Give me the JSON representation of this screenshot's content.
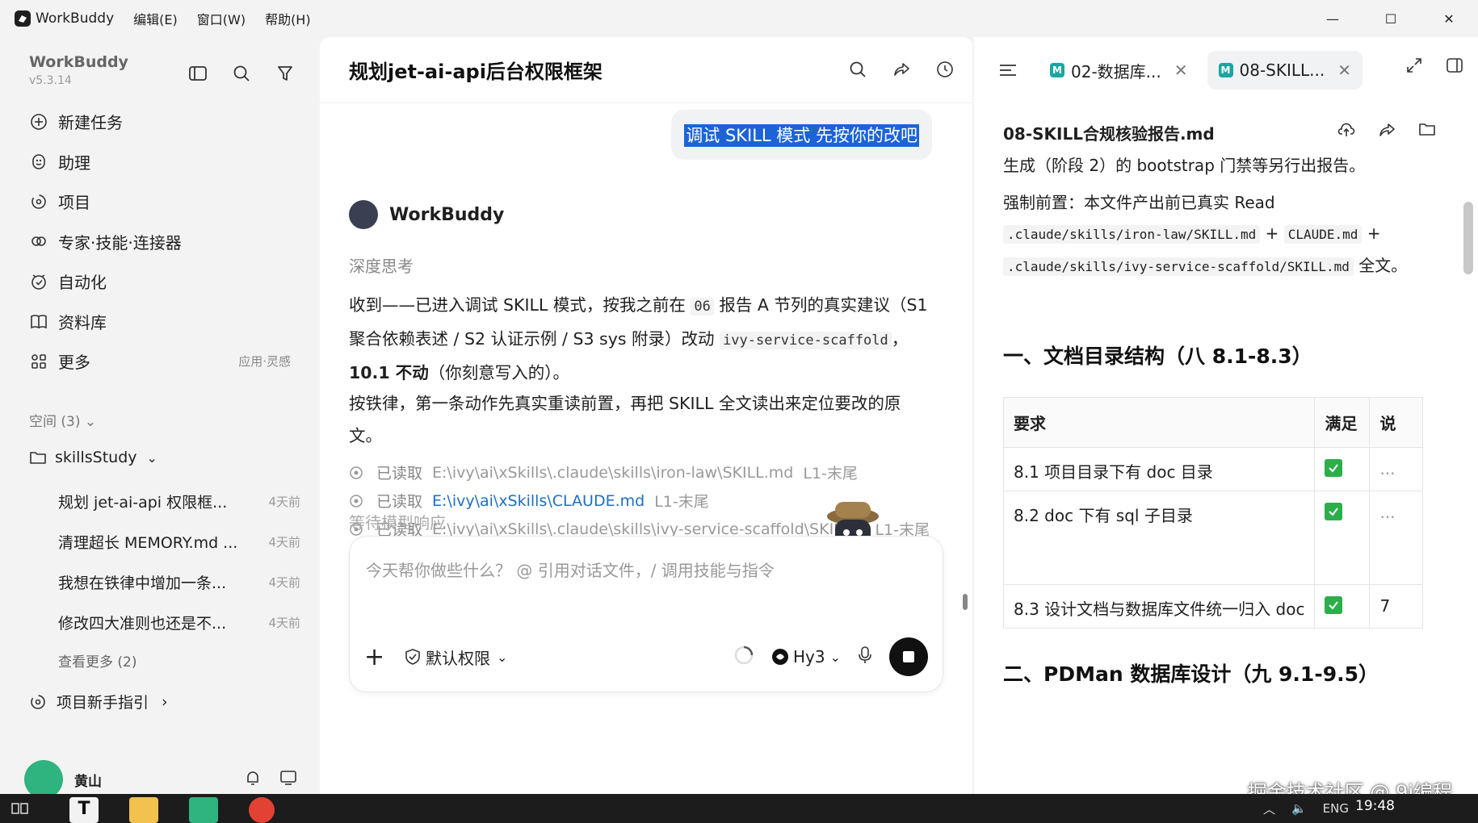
{
  "titlebar": {
    "app_name": "WorkBuddy",
    "menus": [
      "编辑(E)",
      "窗口(W)",
      "帮助(H)"
    ],
    "minimize": "—",
    "maximize": "☐",
    "close": "✕"
  },
  "sidebar": {
    "brand": "WorkBuddy",
    "version": "v5.3.14",
    "nav": [
      {
        "label": "新建任务",
        "icon": "plus-circle-icon"
      },
      {
        "label": "助理",
        "icon": "assistant-icon"
      },
      {
        "label": "项目",
        "icon": "project-icon"
      },
      {
        "label": "专家·技能·连接器",
        "icon": "expert-icon"
      },
      {
        "label": "自动化",
        "icon": "automation-icon"
      },
      {
        "label": "资料库",
        "icon": "library-icon"
      },
      {
        "label": "更多",
        "icon": "more-icon",
        "hint": "应用·灵感"
      }
    ],
    "space_header": "空间 (3)",
    "folder": "skillsStudy",
    "recent": [
      {
        "title": "规划 jet-ai-api 权限框...",
        "date": "4天前"
      },
      {
        "title": "清理超长 MEMORY.md ...",
        "date": "4天前"
      },
      {
        "title": "我想在铁律中增加一条...",
        "date": "4天前"
      },
      {
        "title": "修改四大准则也还是不...",
        "date": "4天前"
      }
    ],
    "see_more": "查看更多 (2)",
    "guide": "项目新手指引",
    "user_name": "黄山"
  },
  "chat": {
    "title": "规划jet-ai-api后台权限框架",
    "user_message": "调试 SKILL 模式 先按你的改吧",
    "bot_name": "WorkBuddy",
    "thinking": "深度思考",
    "p1_a": "收到——已进入调试 SKILL 模式，按我之前在 ",
    "p1_code1": "06",
    "p1_b": " 报告 A 节列的真实建议（S1 聚合依赖表述 / S2 认证示例 / S3 sys 附录）改动 ",
    "p1_code2": "ivy-service-scaffold",
    "p1_c": "，",
    "p1_bold": "10.1 不动",
    "p1_d": "（你刻意写入的）。",
    "p2": "按铁律，第一条动作先真实重读前置，再把 SKILL 全文读出来定位要改的原文。",
    "reads": [
      {
        "label": "已读取",
        "path": "E:\\ivy\\ai\\xSkills\\.claude\\skills\\iron-law\\SKILL.md",
        "range": "L1-末尾",
        "link": false
      },
      {
        "label": "已读取",
        "path": "E:\\ivy\\ai\\xSkills\\CLAUDE.md",
        "range": "L1-末尾",
        "link": true
      },
      {
        "label": "已读取",
        "path": "E:\\ivy\\ai\\xSkills\\.claude\\skills\\ivy-service-scaffold\\SKILL...",
        "range": "L1-末尾",
        "link": false
      }
    ],
    "waiting": "等待模型响应",
    "composer_placeholder": "今天帮你做些什么？  @ 引用对话文件，/ 调用技能与指令",
    "permission": "默认权限",
    "model": "Hy3"
  },
  "doc": {
    "tabs": [
      {
        "label": "02-数据库...",
        "active": false
      },
      {
        "label": "08-SKILL...",
        "active": true
      }
    ],
    "filename": "08-SKILL合规核验报告.md",
    "p_top": "生成（阶段 2）的 bootstrap 门禁等另行出报告。",
    "p_pre_a": "强制前置：本文件产出前已真实 Read",
    "p_pre_code1": ".claude/skills/iron-law/SKILL.md",
    "p_pre_plus1": "+",
    "p_pre_code2": "CLAUDE.md",
    "p_pre_plus2": "+",
    "p_pre_code3": ".claude/skills/ivy-service-scaffold/SKILL.md",
    "p_pre_b": "全文。",
    "h2_1": "一、文档目录结构（八 8.1-8.3）",
    "table_headers": [
      "要求",
      "满足",
      "说"
    ],
    "table_rows": [
      {
        "req": "8.1 项目目录下有 doc 目录",
        "ok": true,
        "note": "..."
      },
      {
        "req": "8.2 doc 下有 sql 子目录",
        "ok": true,
        "note": "..."
      },
      {
        "req": "8.3 设计文档与数据库文件统一归入 doc",
        "ok": true,
        "note": "7"
      }
    ],
    "h2_2": "二、PDMan 数据库设计（九 9.1-9.5）"
  },
  "watermark": "掘金技术社区 @ 9i编程",
  "taskbar": {
    "clock": "19:48",
    "lang": "ENG"
  },
  "colors": {
    "accent_blue": "#1c63d6",
    "check_green": "#2cae4a",
    "md_badge": "#1aa6a0"
  }
}
